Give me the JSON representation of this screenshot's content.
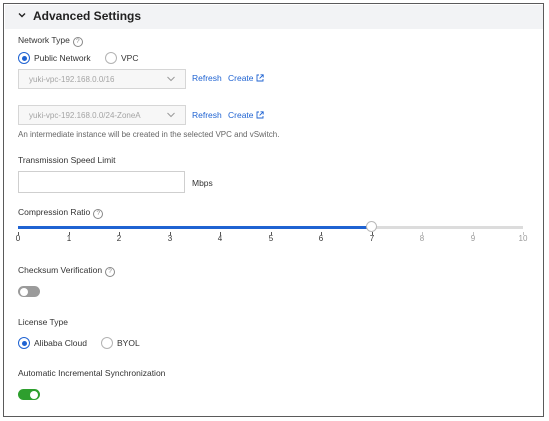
{
  "section": {
    "title": "Advanced Settings"
  },
  "network_type": {
    "label": "Network Type",
    "options": [
      "Public Network",
      "VPC"
    ],
    "selected": "Public Network",
    "vpc_select": {
      "value": "yuki-vpc-192.168.0.0/16",
      "refresh": "Refresh",
      "create": "Create"
    },
    "vswitch_select": {
      "value": "yuki-vpc-192.168.0.0/24-ZoneA",
      "refresh": "Refresh",
      "create": "Create"
    },
    "note": "An intermediate instance will be created in the selected VPC and vSwitch."
  },
  "transmission_speed_limit": {
    "label": "Transmission Speed Limit",
    "value": "",
    "unit": "Mbps"
  },
  "compression_ratio": {
    "label": "Compression Ratio",
    "min": 0,
    "max": 10,
    "value": 7,
    "ticks": [
      "0",
      "1",
      "2",
      "3",
      "4",
      "5",
      "6",
      "7",
      "8",
      "9",
      "10"
    ]
  },
  "checksum_verification": {
    "label": "Checksum Verification",
    "enabled": false
  },
  "license_type": {
    "label": "License Type",
    "options": [
      "Alibaba Cloud",
      "BYOL"
    ],
    "selected": "Alibaba Cloud"
  },
  "automatic_incremental_sync": {
    "label": "Automatic Incremental Synchronization",
    "enabled": true
  },
  "colors": {
    "accent": "#1f63d2",
    "toggle_on": "#2e9f2e",
    "toggle_off": "#9b9b9b"
  }
}
